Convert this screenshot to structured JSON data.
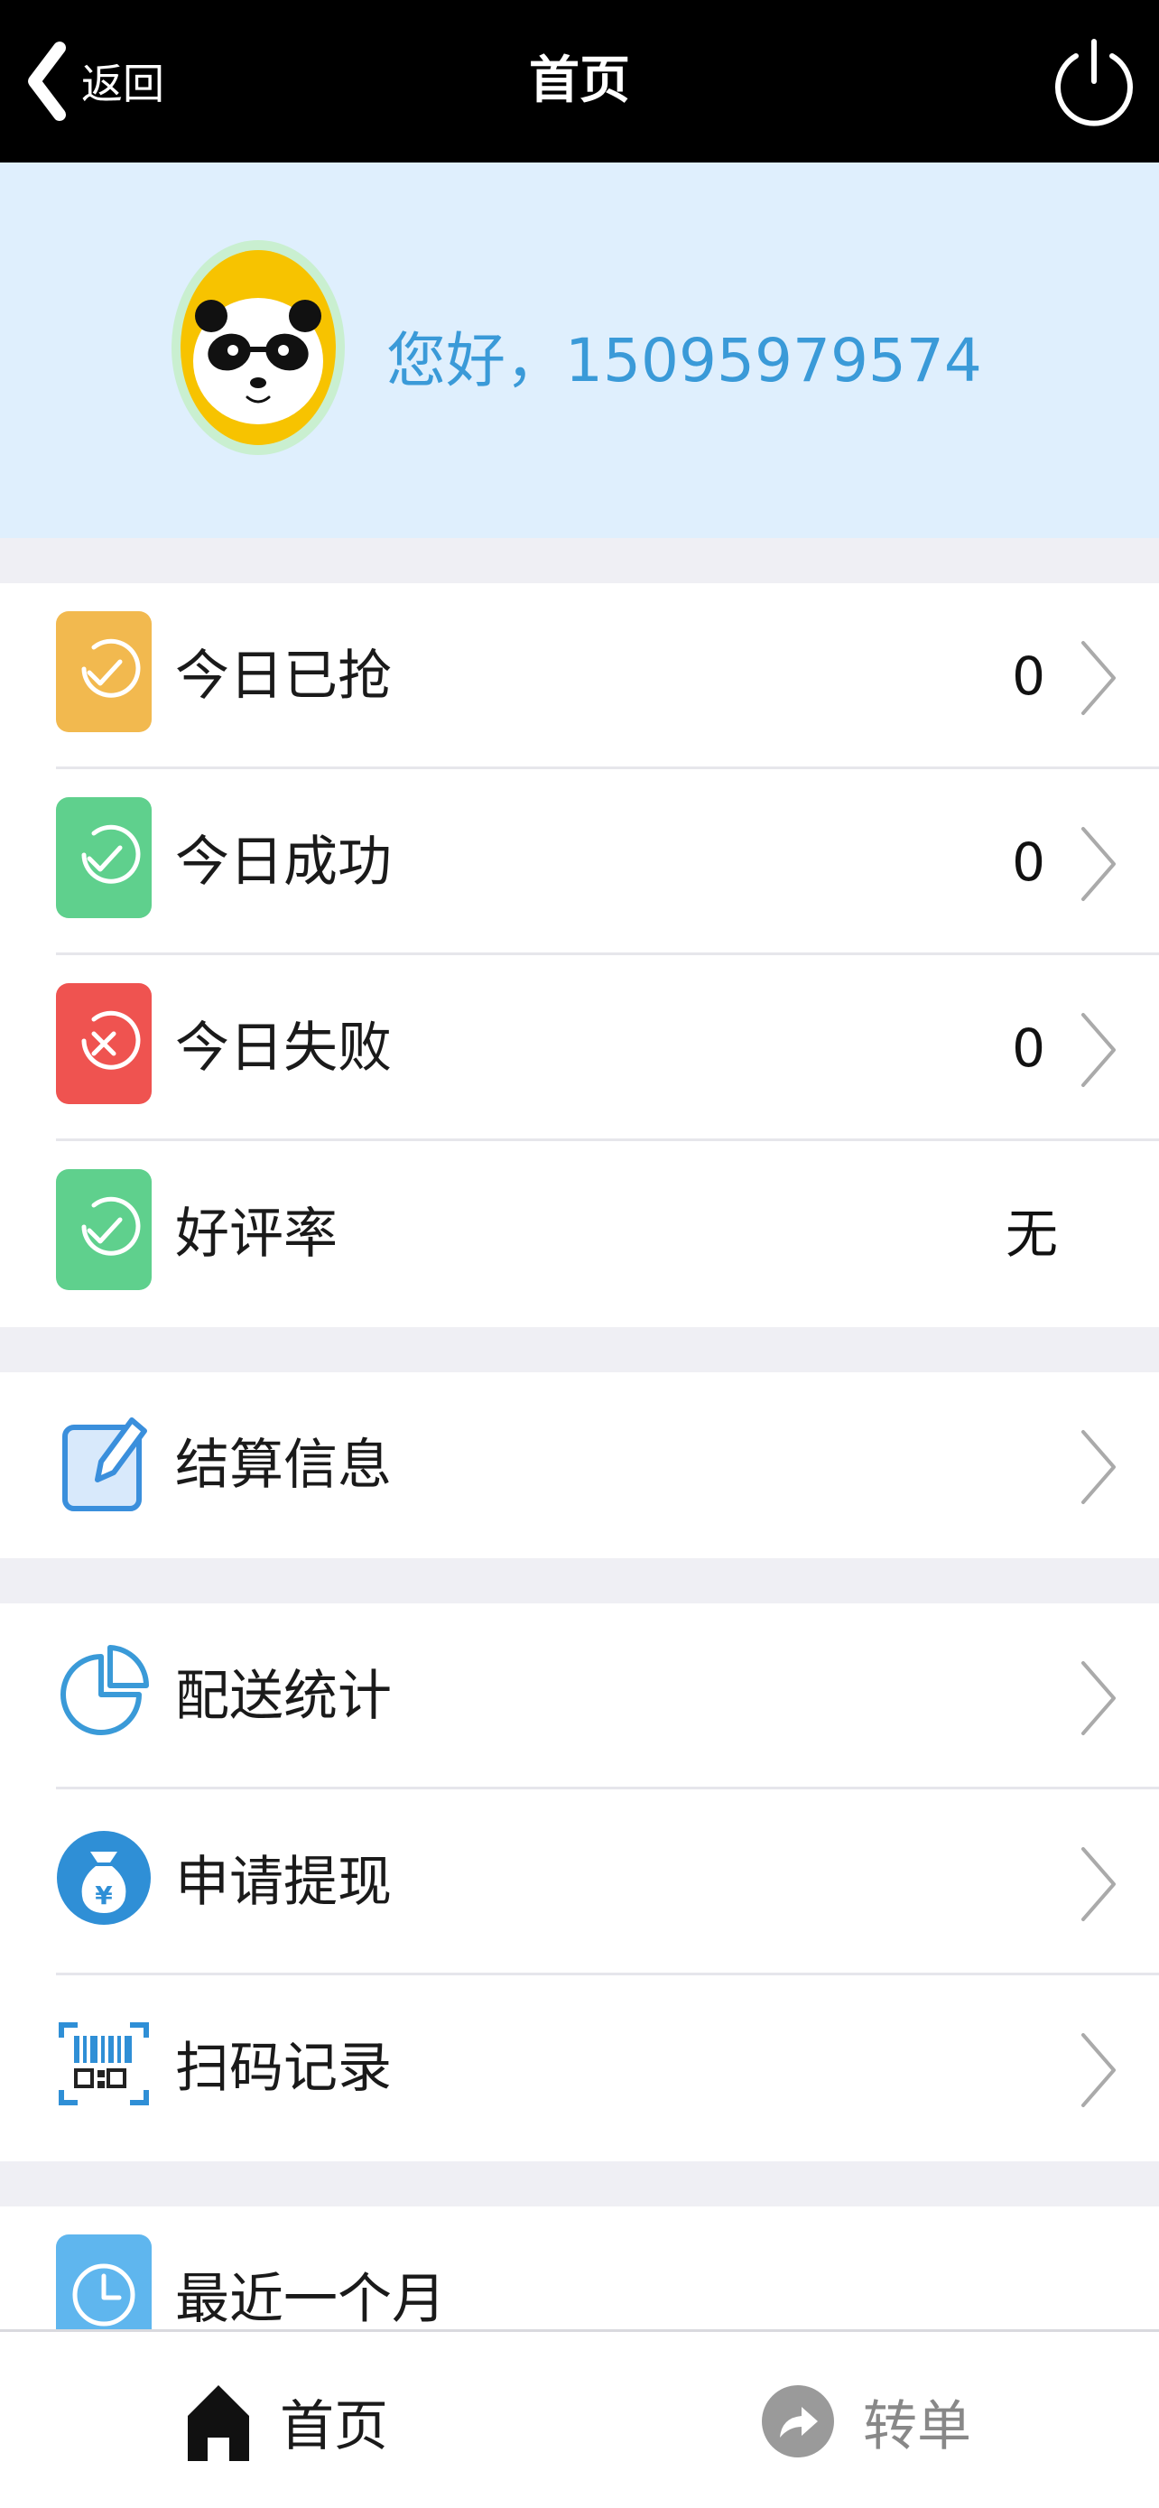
{
  "navbar": {
    "back_label": "返回",
    "title": "首页"
  },
  "profile": {
    "greeting": "您好，15095979574"
  },
  "stats": [
    {
      "label": "今日已抢",
      "value": "0",
      "icon": "check-circle-icon",
      "color": "#f2b94f"
    },
    {
      "label": "今日成功",
      "value": "0",
      "icon": "check-circle-icon",
      "color": "#5fd08d"
    },
    {
      "label": "今日失败",
      "value": "0",
      "icon": "x-circle-icon",
      "color": "#ef5350"
    },
    {
      "label": "好评率",
      "value": "无",
      "icon": "check-circle-icon",
      "color": "#5fd08d"
    }
  ],
  "settlement": {
    "label": "结算信息",
    "icon": "edit-note-icon"
  },
  "tools": [
    {
      "label": "配送统计",
      "icon": "pie-chart-icon"
    },
    {
      "label": "申请提现",
      "icon": "money-bag-icon"
    },
    {
      "label": "扫码记录",
      "icon": "qr-scan-icon"
    }
  ],
  "recent": {
    "label": "最近一个月",
    "icon": "clock-icon"
  },
  "tabbar": {
    "home_label": "首页",
    "transfer_label": "转单"
  },
  "colors": {
    "accent_blue": "#3a9ad8",
    "navbar_bg": "#000000",
    "profile_bg": "#dfeffd"
  }
}
